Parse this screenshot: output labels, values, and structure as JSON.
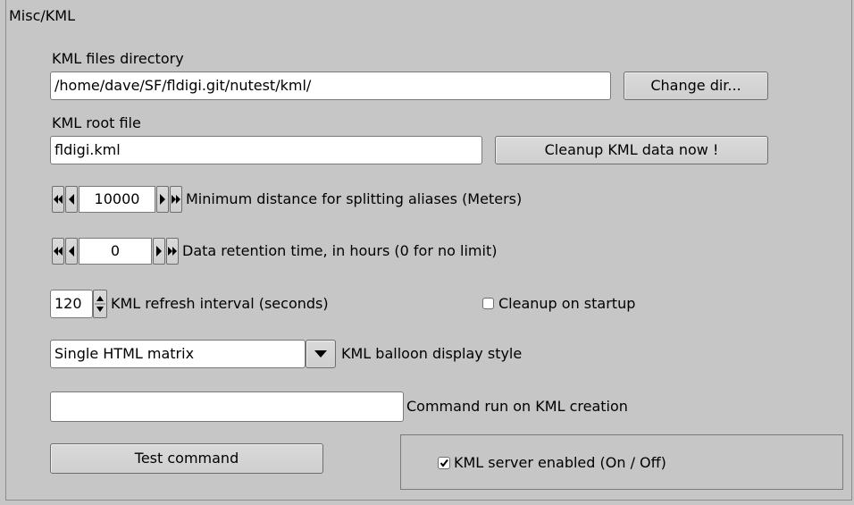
{
  "panel": {
    "title": "Misc/KML"
  },
  "kml_dir": {
    "label": "KML files directory",
    "value": "/home/dave/SF/fldigi.git/nutest/kml/",
    "button": "Change dir..."
  },
  "kml_root": {
    "label": "KML root file",
    "value": "fldigi.kml",
    "button": "Cleanup KML data now !"
  },
  "min_distance": {
    "value": "10000",
    "label": "Minimum distance for splitting aliases (Meters)"
  },
  "retention": {
    "value": "0",
    "label": "Data retention time, in hours (0 for no limit)"
  },
  "refresh": {
    "value": "120",
    "label": "KML refresh interval (seconds)"
  },
  "cleanup_startup": {
    "label": "Cleanup on startup",
    "checked": false
  },
  "balloon": {
    "selected": "Single HTML matrix",
    "label": "KML balloon display style"
  },
  "command": {
    "value": "",
    "label": "Command run on KML creation",
    "button": "Test command"
  },
  "server": {
    "label": "KML server enabled (On / Off)",
    "checked": true
  }
}
